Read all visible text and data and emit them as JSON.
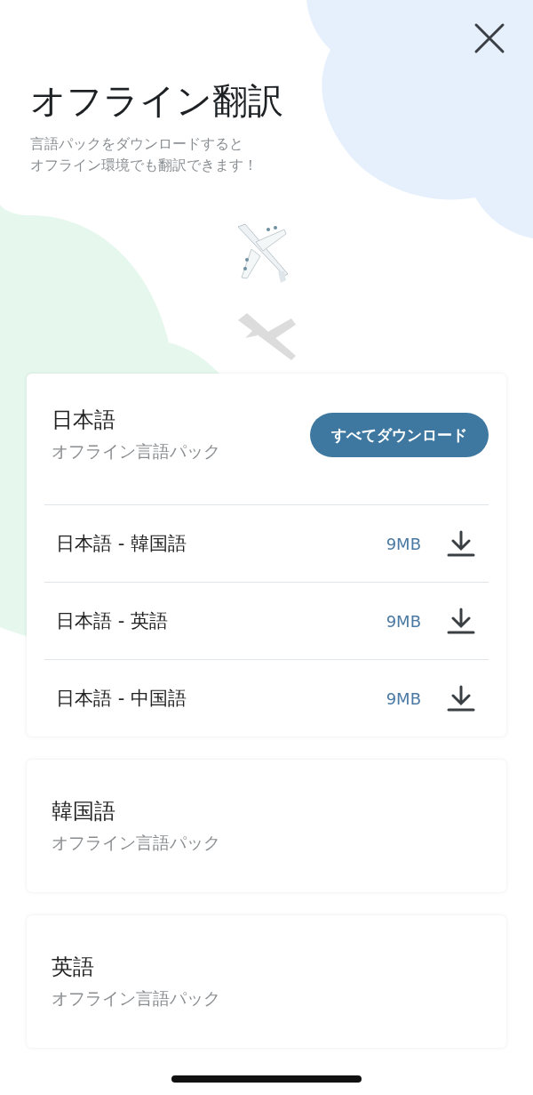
{
  "header": {
    "title": "オフライン翻訳",
    "description_lines": [
      "言語パックをダウンロードすると",
      "オフライン環境でも翻訳できます！"
    ]
  },
  "languages": [
    {
      "title": "日本語",
      "subtitle": "オフライン言語パック",
      "button": "すべてダウンロード",
      "packages": [
        {
          "name": "日本語 - 韓国語",
          "size": "9MB"
        },
        {
          "name": "日本語 - 英語",
          "size": "9MB"
        },
        {
          "name": "日本語 - 中国語",
          "size": "9MB"
        }
      ]
    },
    {
      "title": "韓国語",
      "subtitle": "オフライン言語パック"
    },
    {
      "title": "英語",
      "subtitle": "オフライン言語パック"
    }
  ]
}
